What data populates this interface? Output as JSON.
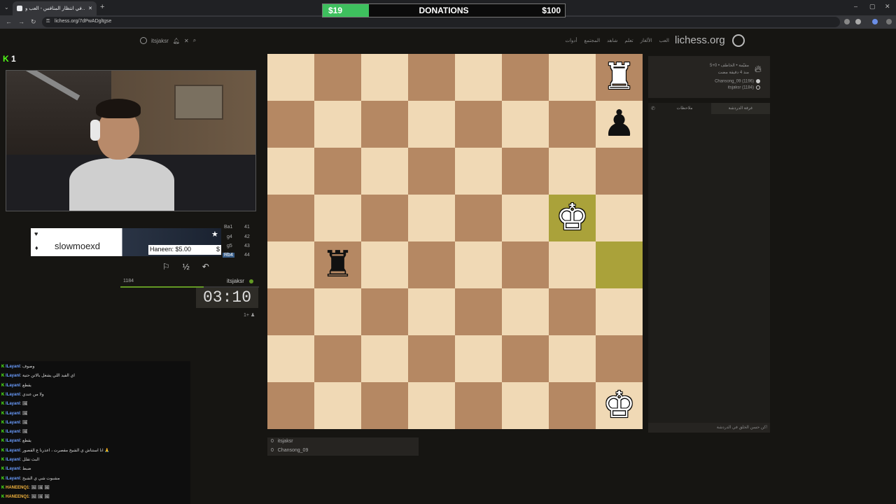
{
  "browser": {
    "tab_title": "في انتظار المنافس - العب و…",
    "address": "lichess.org/7dPwADgltgse"
  },
  "donations": {
    "current": "$19",
    "title": "DONATIONS",
    "goal": "$100",
    "progress_fraction": 0.19
  },
  "lichess_header": {
    "logo": "lichess.org",
    "user": "itsjaksr",
    "nav": [
      "العب",
      "الألغاز",
      "تعلم",
      "شاهد",
      "المجتمع",
      "أدوات"
    ]
  },
  "stream": {
    "kick_count": "1"
  },
  "song": {
    "name": "slowmoexd"
  },
  "tip": {
    "text": "Haneen: $5.00",
    "symbol": "$"
  },
  "moves": [
    {
      "num": "41",
      "san": "Ba1"
    },
    {
      "num": "42",
      "san": "g4"
    },
    {
      "num": "43",
      "san": "g5"
    },
    {
      "num": "44",
      "san": "Rb4"
    }
  ],
  "controls": {
    "flag": "⚐",
    "draw": "½",
    "takeback": "↶"
  },
  "clock": {
    "opponent_rating": "1184",
    "me": "itsjaksr",
    "time": "03:10",
    "berserk": "1+"
  },
  "chat": [
    {
      "user": "lLayanl",
      "msg": ": وصوف"
    },
    {
      "user": "lLayanl",
      "msg": ": اي الفيد اللي يشغل بالاتن حتية"
    },
    {
      "user": "lLayanl",
      "msg": ": يقطع"
    },
    {
      "user": "lLayanl",
      "msg": ": ولا من عندي"
    },
    {
      "user": "lLayanl",
      "msg": ": 🖼"
    },
    {
      "user": "lLayanl",
      "msg": ": 🖼"
    },
    {
      "user": "lLayanl",
      "msg": ": 🖼"
    },
    {
      "user": "lLayanl",
      "msg": ": 🖼"
    },
    {
      "user": "lLayanl",
      "msg": ": يقطع"
    },
    {
      "user": "lLayanl",
      "msg": ": انا استناش ي الشيخ مقصرت ، اعذرنا ع القصور 🙏"
    },
    {
      "user": "lLayanl",
      "msg": ": البث تقلل"
    },
    {
      "user": "lLayanl",
      "msg": ": ضبط"
    },
    {
      "user": "lLayanl",
      "msg": ": مشبوت شي ي الشيخ"
    },
    {
      "user": "HANEENQ1",
      "msg": ": 🖼 🖼 🖼"
    },
    {
      "user": "HANEENQ1",
      "msg": ": 🖼 🖼 🖼"
    }
  ],
  "board": {
    "pieces": [
      {
        "file": 7,
        "rank": 0,
        "glyph": "♜",
        "color": "white"
      },
      {
        "file": 7,
        "rank": 1,
        "glyph": "♟",
        "color": "black"
      },
      {
        "file": 6,
        "rank": 3,
        "glyph": "♚",
        "color": "white"
      },
      {
        "file": 1,
        "rank": 4,
        "glyph": "♜",
        "color": "black"
      },
      {
        "file": 7,
        "rank": 7,
        "glyph": "♚",
        "color": "white"
      }
    ],
    "highlights": [
      {
        "file": 6,
        "rank": 3
      },
      {
        "file": 7,
        "rank": 4
      }
    ]
  },
  "players": [
    {
      "score": "0",
      "name": "itsjaksr"
    },
    {
      "score": "0",
      "name": "Chansong_09"
    }
  ],
  "game_info": {
    "mode": "5+0 • مقيّمة • الخاطف",
    "started": "منذ 4 دقيقة مضت",
    "white": "Chansong_09 (1196)",
    "black": "itsjaksr (1184)"
  },
  "chat_panel": {
    "tab_room": "غرفة الدردشة",
    "tab_notes": "ملاحظات",
    "placeholder": "كن حسن الخلق في الدردشة!"
  }
}
